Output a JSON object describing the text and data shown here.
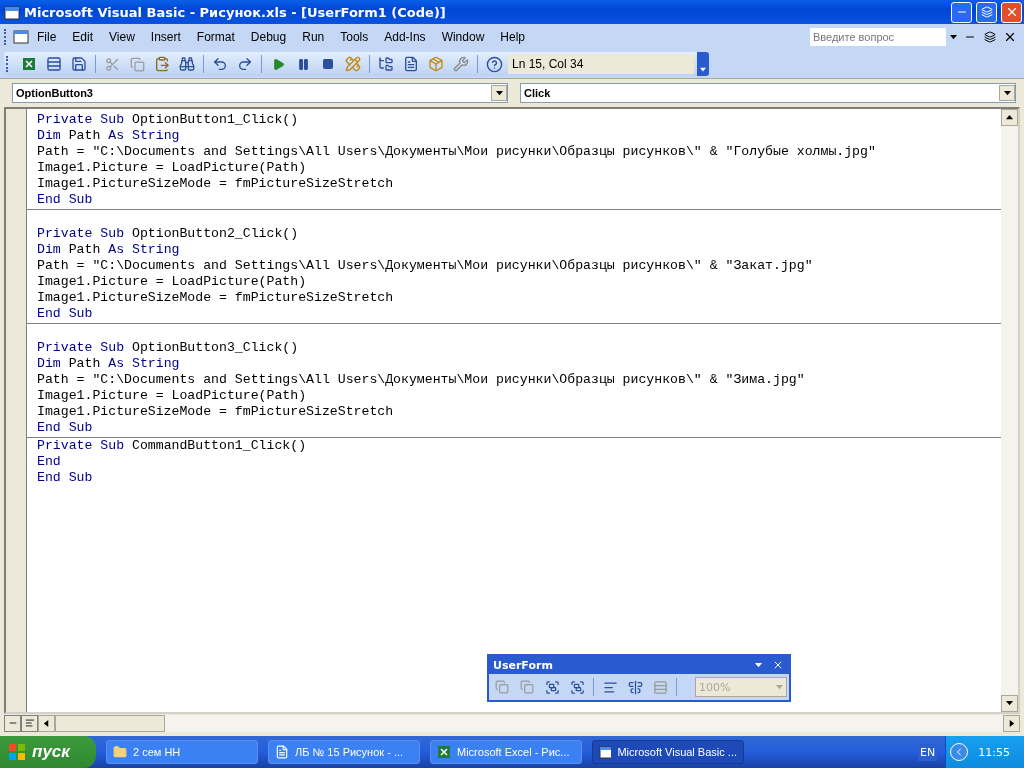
{
  "window": {
    "title": "Microsoft Visual Basic - Рисунок.xls - [UserForm1 (Code)]"
  },
  "menu": [
    {
      "label": "File"
    },
    {
      "label": "Edit"
    },
    {
      "label": "View"
    },
    {
      "label": "Insert"
    },
    {
      "label": "Format"
    },
    {
      "label": "Debug"
    },
    {
      "label": "Run"
    },
    {
      "label": "Tools"
    },
    {
      "label": "Add-Ins"
    },
    {
      "label": "Window"
    },
    {
      "label": "Help"
    }
  ],
  "help_search": {
    "placeholder": "Введите вопрос"
  },
  "toolbar": {
    "position": "Ln 15, Col 34"
  },
  "object_combo": {
    "value": "OptionButton3"
  },
  "procedure_combo": {
    "value": "Click"
  },
  "code": {
    "procedures": [
      {
        "blank_line_before": false,
        "lines": [
          [
            {
              "kind": "keyword",
              "text": "Private Sub"
            },
            {
              "kind": "plain",
              "text": " OptionButton1_Click()"
            }
          ],
          [
            {
              "kind": "keyword",
              "text": "Dim"
            },
            {
              "kind": "plain",
              "text": " Path "
            },
            {
              "kind": "keyword",
              "text": "As String"
            }
          ],
          [
            {
              "kind": "plain",
              "text": "Path = \"C:\\Documents and Settings\\All Users\\Документы\\Мои рисунки\\Образцы рисунков\\\" & \"Голубые холмы.jpg\""
            }
          ],
          [
            {
              "kind": "plain",
              "text": "Image1.Picture = LoadPicture(Path)"
            }
          ],
          [
            {
              "kind": "plain",
              "text": "Image1.PictureSizeMode = fmPictureSizeStretch"
            }
          ],
          [
            {
              "kind": "keyword",
              "text": "End Sub"
            }
          ]
        ]
      },
      {
        "blank_line_before": true,
        "lines": [
          [
            {
              "kind": "keyword",
              "text": "Private Sub"
            },
            {
              "kind": "plain",
              "text": " OptionButton2_Click()"
            }
          ],
          [
            {
              "kind": "keyword",
              "text": "Dim"
            },
            {
              "kind": "plain",
              "text": " Path "
            },
            {
              "kind": "keyword",
              "text": "As String"
            }
          ],
          [
            {
              "kind": "plain",
              "text": "Path = \"C:\\Documents and Settings\\All Users\\Документы\\Мои рисунки\\Образцы рисунков\\\" & \"Закат.jpg\""
            }
          ],
          [
            {
              "kind": "plain",
              "text": "Image1.Picture = LoadPicture(Path)"
            }
          ],
          [
            {
              "kind": "plain",
              "text": "Image1.PictureSizeMode = fmPictureSizeStretch"
            }
          ],
          [
            {
              "kind": "keyword",
              "text": "End Sub"
            }
          ]
        ]
      },
      {
        "blank_line_before": true,
        "lines": [
          [
            {
              "kind": "keyword",
              "text": "Private Sub"
            },
            {
              "kind": "plain",
              "text": " OptionButton3_Click()"
            }
          ],
          [
            {
              "kind": "keyword",
              "text": "Dim"
            },
            {
              "kind": "plain",
              "text": " Path "
            },
            {
              "kind": "keyword",
              "text": "As String"
            }
          ],
          [
            {
              "kind": "plain",
              "text": "Path = \"C:\\Documents and Settings\\All Users\\Документы\\Мои рисунки\\Образцы рисунков\\\" & \"Зима.jpg\""
            }
          ],
          [
            {
              "kind": "plain",
              "text": "Image1.Picture = LoadPicture(Path)"
            }
          ],
          [
            {
              "kind": "plain",
              "text": "Image1.PictureSizeMode = fmPictureSizeStretch"
            }
          ],
          [
            {
              "kind": "keyword",
              "text": "End Sub"
            }
          ]
        ]
      },
      {
        "blank_line_before": false,
        "lines": [
          [
            {
              "kind": "keyword",
              "text": "Private Sub"
            },
            {
              "kind": "plain",
              "text": " CommandButton1_Click()"
            }
          ],
          [
            {
              "kind": "keyword",
              "text": "End"
            }
          ],
          [
            {
              "kind": "keyword",
              "text": "End Sub"
            }
          ]
        ]
      }
    ]
  },
  "userform_toolbar": {
    "title": "UserForm",
    "zoom": "100%",
    "zoom_disabled": true
  },
  "taskbar": {
    "start": "пуск",
    "tasks": [
      {
        "kind": "folder",
        "label": "2 сем НН",
        "selected": false
      },
      {
        "kind": "word",
        "label": "ЛБ № 15 Рисунок - ...",
        "selected": false
      },
      {
        "kind": "excel",
        "label": "Microsoft Excel - Рис...",
        "selected": false
      },
      {
        "kind": "vb",
        "label": "Microsoft Visual Basic ...",
        "selected": true
      }
    ],
    "language": "EN",
    "time": "11:55"
  }
}
